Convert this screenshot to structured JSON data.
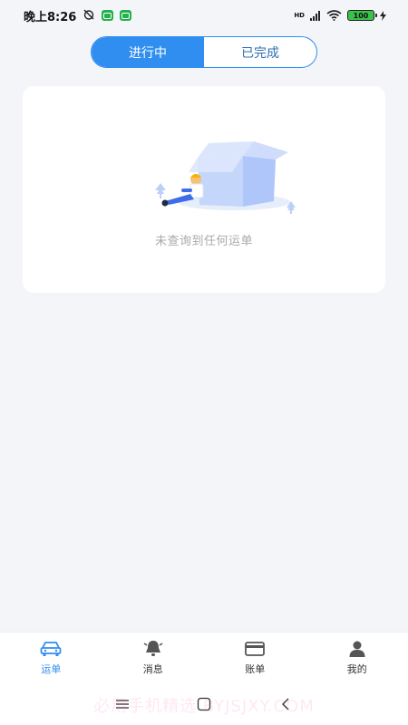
{
  "status_bar": {
    "time": "晚上8:26",
    "network": "HD",
    "battery": "100"
  },
  "tabs": {
    "active": "进行中",
    "inactive": "已完成"
  },
  "empty_state": {
    "message": "未查询到任何运单"
  },
  "bottom_nav": {
    "items": [
      {
        "label": "运单",
        "icon": "truck-icon",
        "active": true
      },
      {
        "label": "消息",
        "icon": "bell-icon",
        "active": false
      },
      {
        "label": "账单",
        "icon": "card-icon",
        "active": false
      },
      {
        "label": "我的",
        "icon": "user-icon",
        "active": false
      }
    ]
  },
  "watermark": "必用手机精选 BYJSJXY.COM",
  "colors": {
    "accent": "#2f8ef0",
    "background": "#f4f5f9",
    "muted_text": "#a7a9af"
  }
}
